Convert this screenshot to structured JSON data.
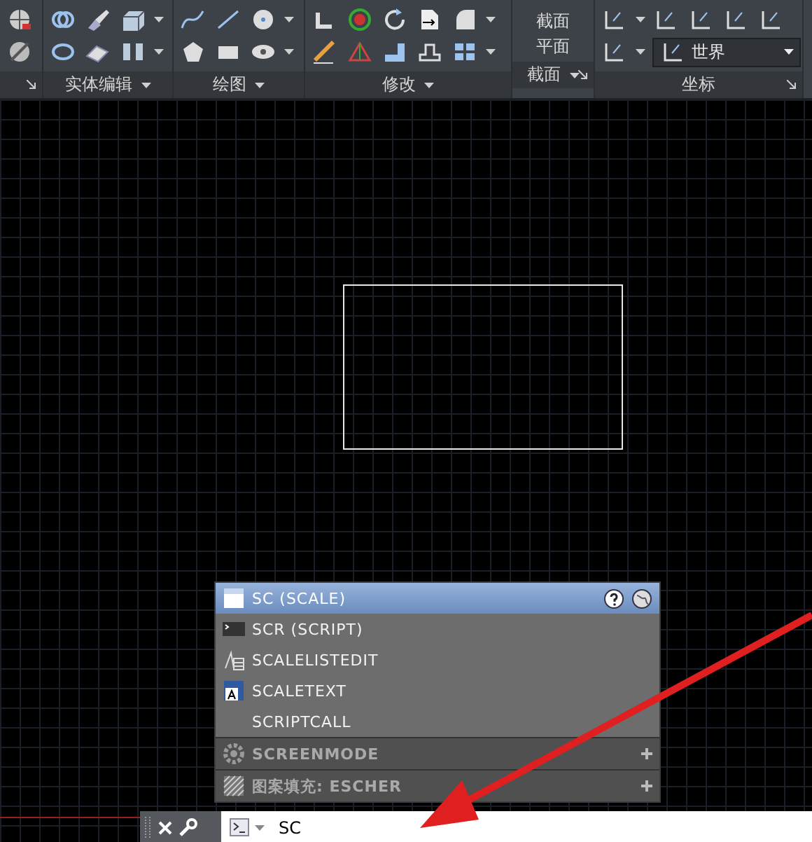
{
  "ribbon": {
    "panels": [
      {
        "label": "实体编辑"
      },
      {
        "label": "绘图"
      },
      {
        "label": "修改"
      },
      {
        "label": "截面"
      },
      {
        "label": "坐标"
      }
    ],
    "section_button": [
      "截面",
      "平面"
    ],
    "ucs_dropdown": {
      "value": "世界"
    }
  },
  "autocomplete": {
    "items": [
      {
        "kind": "command",
        "label": "SC (SCALE)",
        "selected": true
      },
      {
        "kind": "command",
        "label": "SCR (SCRIPT)",
        "selected": false
      },
      {
        "kind": "command",
        "label": "SCALELISTEDIT",
        "selected": false
      },
      {
        "kind": "command",
        "label": "SCALETEXT",
        "selected": false
      },
      {
        "kind": "command",
        "label": "SCRIPTCALL",
        "selected": false
      },
      {
        "kind": "category",
        "label": "SCREENMODE",
        "selected": false
      },
      {
        "kind": "category",
        "label": "图案填充: ESCHER",
        "selected": false
      }
    ]
  },
  "command_line": {
    "value": "SC"
  }
}
